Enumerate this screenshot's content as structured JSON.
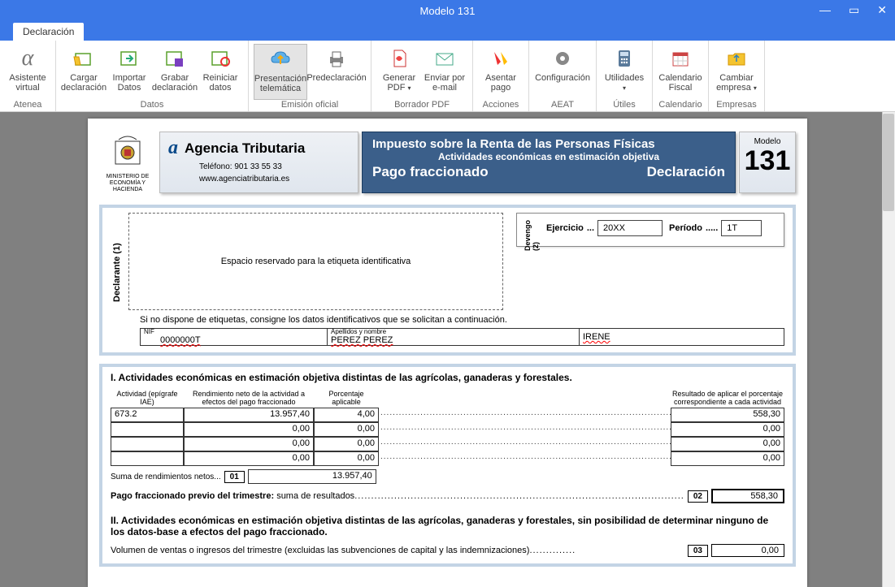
{
  "window": {
    "title": "Modelo 131"
  },
  "tabs": {
    "declaracion": "Declaración"
  },
  "ribbon": {
    "atenea": {
      "asistente": "Asistente virtual",
      "group": "Atenea"
    },
    "datos": {
      "cargar": "Cargar declaración",
      "importar": "Importar Datos",
      "grabar": "Grabar declaración",
      "reiniciar": "Reiniciar datos",
      "group": "Datos"
    },
    "emision": {
      "presentacion": "Presentación telemática",
      "predeclaracion": "Predeclaración",
      "group": "Emisión oficial"
    },
    "borrador": {
      "generar": "Generar PDF",
      "enviar": "Enviar por e-mail",
      "group": "Borrador PDF"
    },
    "acciones": {
      "asentar": "Asentar pago",
      "group": "Acciones"
    },
    "aeat": {
      "config": "Configuración",
      "group": "AEAT"
    },
    "utiles": {
      "utilidades": "Utilidades",
      "group": "Útiles"
    },
    "calendario": {
      "calendario": "Calendario Fiscal",
      "group": "Calendario"
    },
    "empresas": {
      "cambiar": "Cambiar empresa",
      "group": "Empresas"
    }
  },
  "page": {
    "ministry": "MINISTERIO DE ECONOMÍA Y HACIENDA",
    "agency": {
      "name": "Agencia Tributaria",
      "tel_label": "Teléfono:",
      "tel": "901 33 55 33",
      "url": "www.agenciatributaria.es"
    },
    "bluebox": {
      "title": "Impuesto sobre la Renta de las Personas Físicas",
      "sub": "Actividades económicas en estimación objetiva",
      "left": "Pago fraccionado",
      "right": "Declaración"
    },
    "modelo": {
      "label": "Modelo",
      "num": "131"
    },
    "devengo": {
      "label": "Devengo (2)",
      "ejercicio_label": "Ejercicio",
      "ejercicio": "20XX",
      "periodo_label": "Período",
      "periodo": "1T"
    },
    "declarante": {
      "label": "Declarante (1)",
      "etiqueta": "Espacio reservado para la etiqueta identificativa",
      "note": "Si no dispone de etiquetas, consigne los datos identificativos que se solicitan a continuación."
    },
    "nif": {
      "label": "NIF",
      "value": "0000000T",
      "apellidos_label": "Apellidos y nombre",
      "apellidos": "PEREZ PEREZ",
      "nombre": "IRENE"
    },
    "sectionI": {
      "title": "I.  Actividades económicas en estimación objetiva distintas de las agrícolas, ganaderas y forestales.",
      "headers": {
        "actividad": "Actividad (epígrafe IAE)",
        "rendimiento": "Rendimiento neto de la actividad a efectos del pago fraccionado",
        "porcentaje": "Porcentaje aplicable",
        "resultado": "Resultado de aplicar el porcentaje correspondiente a cada actividad"
      },
      "rows": [
        {
          "actividad": "673.2",
          "rendimiento": "13.957,40",
          "porcentaje": "4,00",
          "resultado": "558,30"
        },
        {
          "actividad": "",
          "rendimiento": "0,00",
          "porcentaje": "0,00",
          "resultado": "0,00"
        },
        {
          "actividad": "",
          "rendimiento": "0,00",
          "porcentaje": "0,00",
          "resultado": "0,00"
        },
        {
          "actividad": "",
          "rendimiento": "0,00",
          "porcentaje": "0,00",
          "resultado": "0,00"
        }
      ],
      "suma_label": "Suma de rendimientos netos",
      "suma_box": "01",
      "suma_value": "13.957,40",
      "pago_label": "Pago fraccionado previo del trimestre:",
      "pago_sub": "suma de resultados",
      "pago_box": "02",
      "pago_value": "558,30"
    },
    "sectionII": {
      "title": "II.  Actividades económicas en estimación objetiva distintas de las agrícolas, ganaderas y forestales, sin posibilidad de determinar ninguno de los datos-base a efectos del pago fraccionado.",
      "volumen_label": "Volumen de ventas o ingresos del trimestre (excluidas las subvenciones de capital y las indemnizaciones)",
      "volumen_box": "03",
      "volumen_value": "0,00"
    }
  }
}
